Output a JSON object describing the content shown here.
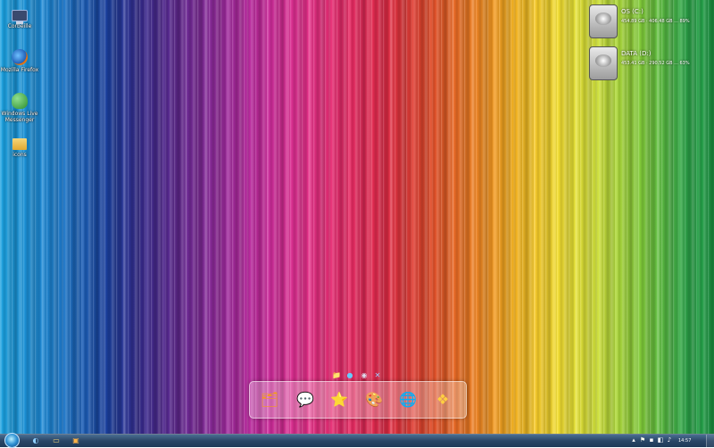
{
  "desktop": {
    "icons": [
      {
        "label": "Corbeille",
        "icon": "recycle-bin-icon"
      },
      {
        "label": "Mozilla Firefox",
        "icon": "firefox-icon"
      },
      {
        "label": "Windows Live Messenger",
        "icon": "messenger-icon"
      },
      {
        "label": "icons",
        "icon": "folder-icon"
      }
    ]
  },
  "drives": [
    {
      "name": "OS (C:)",
      "stats": "454.89 GB · 406.48 GB ... 89%",
      "icon": "hard-drive-icon"
    },
    {
      "name": "DATA (D:)",
      "stats": "453.41 GB · 290.52 GB ... 63%",
      "icon": "hard-drive-icon"
    }
  ],
  "dock": {
    "items": [
      {
        "glyph": "🗂",
        "icon": "office-icon"
      },
      {
        "glyph": "💬",
        "icon": "chat-icon"
      },
      {
        "glyph": "⭐",
        "icon": "star-icon"
      },
      {
        "glyph": "🎨",
        "icon": "paint-icon"
      },
      {
        "glyph": "🌐",
        "icon": "internet-explorer-icon"
      },
      {
        "glyph": "❖",
        "icon": "windows-logo-icon"
      }
    ],
    "stack": [
      {
        "glyph": "📁",
        "icon": "stack-folder-icon"
      },
      {
        "glyph": "●",
        "icon": "stack-globe-icon"
      },
      {
        "glyph": "◉",
        "icon": "stack-camera-icon"
      },
      {
        "glyph": "✕",
        "icon": "stack-close-icon"
      }
    ]
  },
  "taskbar": {
    "pinned": [
      {
        "glyph": "◐",
        "icon": "ie-taskbar-icon"
      },
      {
        "glyph": "▭",
        "icon": "explorer-taskbar-icon"
      },
      {
        "glyph": "▣",
        "icon": "media-taskbar-icon"
      }
    ],
    "tray": [
      {
        "glyph": "▴",
        "icon": "tray-arrow-icon"
      },
      {
        "glyph": "⚑",
        "icon": "flag-icon"
      },
      {
        "glyph": "▪",
        "icon": "network-icon"
      },
      {
        "glyph": "◧",
        "icon": "tray-app-icon"
      },
      {
        "glyph": "♪",
        "icon": "volume-icon"
      }
    ],
    "clock": "14:57"
  }
}
